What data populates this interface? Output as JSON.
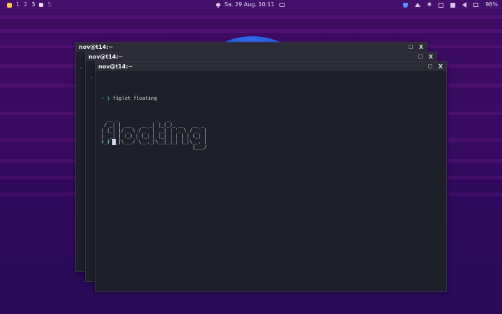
{
  "topbar": {
    "workspaces": [
      "1",
      "2",
      "3",
      "5"
    ],
    "clock": "Sa. 29 Aug. 10:11",
    "battery": "98%",
    "icons": [
      "workspace-icon",
      "bell-icon",
      "cloud-icon",
      "shield-icon",
      "mount-icon",
      "bluetooth-icon",
      "box-icon",
      "camera-icon",
      "volume-icon",
      "monitor-icon"
    ],
    "bluetooth_glyph": "✱"
  },
  "windows": [
    {
      "title": "nov@t14:~",
      "max_glyph": "□",
      "close_glyph": "X",
      "prompt": "~"
    },
    {
      "title": "nov@t14:~",
      "max_glyph": "□",
      "close_glyph": "X",
      "prompt": "~"
    },
    {
      "title": "nov@t14:~",
      "max_glyph": "□",
      "close_glyph": "X"
    }
  ],
  "terminal": {
    "prompt_dir": "~",
    "prompt_arrow": "❯",
    "command": "figlet floating",
    "figlet_output": "  __ _             _   _             \n / _| | ___   __ _| |_(_)_ __   __ _ \n| |_| |/ _ \\ / _` | __| | '_ \\ / _` |\n|  _| | (_) | (_| | |_| | | | | (_| |\n|_| |_|\\___/ \\__,_|\\__|_|_| |_|\\__, |\n                                |___/ ",
    "prompt2_dir": "~",
    "prompt2_arrow": "❯"
  },
  "colors": {
    "accent": "#56b6c2",
    "terminal_bg": "#1e2029",
    "topbar_bg": "#43116b",
    "wallpaper": "#2c0a57"
  }
}
